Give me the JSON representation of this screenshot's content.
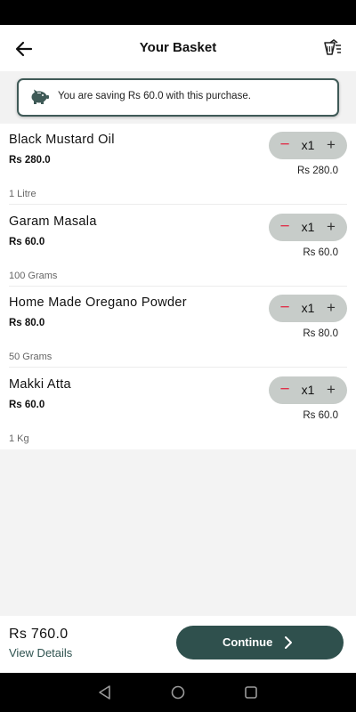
{
  "header": {
    "title": "Your Basket",
    "back_icon": "arrow-left-icon",
    "clear_icon": "clear-basket-icon"
  },
  "savings": {
    "icon": "piggy-bank-icon",
    "text": "You are saving Rs 60.0 with this purchase."
  },
  "items": [
    {
      "name": "Black Mustard Oil",
      "price": "Rs 280.0",
      "unit": "1 Litre",
      "qty": "x1",
      "total": "Rs 280.0"
    },
    {
      "name": "Garam Masala",
      "price": "Rs 60.0",
      "unit": "100 Grams",
      "qty": "x1",
      "total": "Rs 60.0"
    },
    {
      "name": "Home Made Oregano Powder",
      "price": "Rs 80.0",
      "unit": "50 Grams",
      "qty": "x1",
      "total": "Rs 80.0"
    },
    {
      "name": "Makki Atta",
      "price": "Rs 60.0",
      "unit": "1 Kg",
      "qty": "x1",
      "total": "Rs 60.0"
    }
  ],
  "qty_controls": {
    "minus": "−",
    "plus": "+"
  },
  "footer": {
    "total": "Rs 760.0",
    "view_details": "View Details",
    "continue_label": "Continue"
  },
  "colors": {
    "brand": "#2f504d",
    "banner_border": "#3f5a57",
    "qty_bg": "#c7ccc9",
    "minus": "#e0304a"
  }
}
